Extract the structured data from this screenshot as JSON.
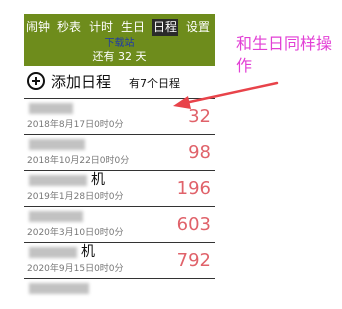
{
  "header": {
    "tabs": [
      {
        "label": "闹钟",
        "active": false
      },
      {
        "label": "秒表",
        "active": false
      },
      {
        "label": "计时",
        "active": false
      },
      {
        "label": "生日",
        "active": false
      },
      {
        "label": "日程",
        "active": true
      },
      {
        "label": "设置",
        "active": false
      }
    ],
    "download_link": "下载站",
    "countdown": "还有 32 天"
  },
  "add_event": {
    "icon": "plus-circle-icon",
    "label": "添加日程",
    "count_text": "有7个日程"
  },
  "events": [
    {
      "title_suffix": "",
      "date": "2018年8月17日0时0分",
      "days": "32"
    },
    {
      "title_suffix": "",
      "date": "2018年10月22日0时0分",
      "days": "98"
    },
    {
      "title_suffix": "机",
      "date": "2019年1月28日0时0分",
      "days": "196"
    },
    {
      "title_suffix": "",
      "date": "2020年3月10日0时0分",
      "days": "603"
    },
    {
      "title_suffix": "机",
      "date": "2020年9月15日0时0分",
      "days": "792"
    }
  ],
  "annotation": {
    "text": "和生日同样操作",
    "color": "#e23fd5",
    "arrow_color": "#e8434a"
  },
  "colors": {
    "header_bg": "#6e8c1c",
    "days_color": "#e0626a",
    "link_color": "#1f3aa8"
  }
}
